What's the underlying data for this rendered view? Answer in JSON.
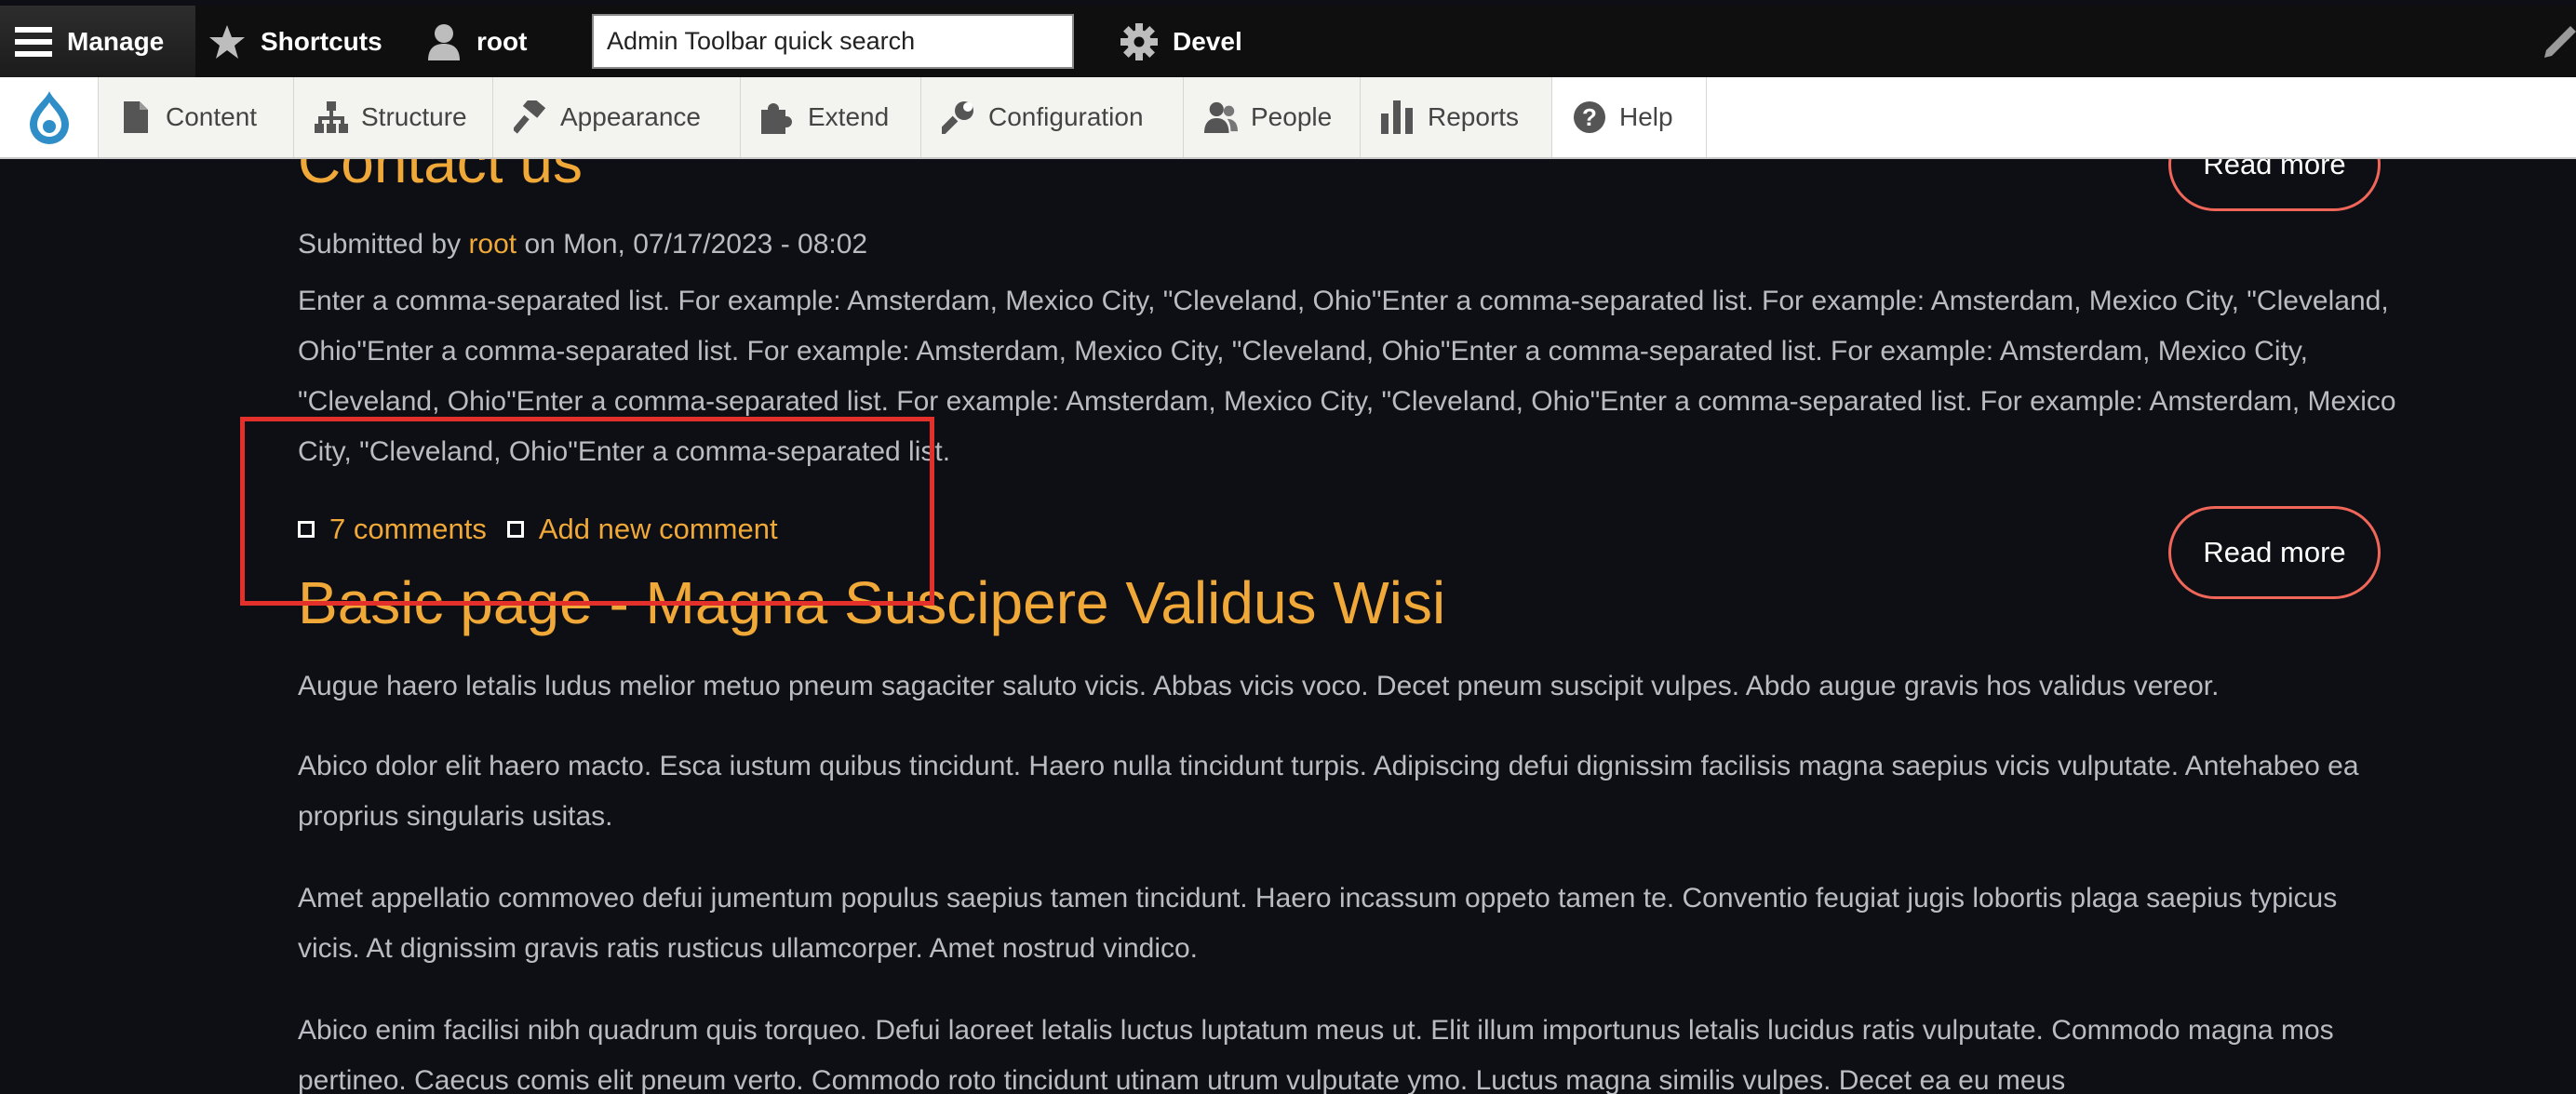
{
  "toolbar": {
    "manage_label": "Manage",
    "shortcuts_label": "Shortcuts",
    "user_label": "root",
    "search_placeholder": "Admin Toolbar quick search",
    "devel_label": "Devel"
  },
  "tray": {
    "items": [
      {
        "label": "Content",
        "icon": "file-icon"
      },
      {
        "label": "Structure",
        "icon": "sitemap-icon"
      },
      {
        "label": "Appearance",
        "icon": "brush-icon"
      },
      {
        "label": "Extend",
        "icon": "puzzle-icon"
      },
      {
        "label": "Configuration",
        "icon": "wrench-icon"
      },
      {
        "label": "People",
        "icon": "people-icon"
      },
      {
        "label": "Reports",
        "icon": "bar-chart-icon"
      },
      {
        "label": "Help",
        "icon": "help-icon"
      }
    ]
  },
  "nodes": [
    {
      "title": "Contact us",
      "submitted_prefix": "Submitted by ",
      "author": "root",
      "submitted_suffix": " on Mon, 07/17/2023 - 08:02",
      "body": "Enter a comma-separated list. For example: Amsterdam, Mexico City, \"Cleveland, Ohio\"Enter a comma-separated list. For example: Amsterdam, Mexico City, \"Cleveland, Ohio\"Enter a comma-separated list. For example: Amsterdam, Mexico City, \"Cleveland, Ohio\"Enter a comma-separated list. For example: Amsterdam, Mexico City, \"Cleveland, Ohio\"Enter a comma-separated list. For example: Amsterdam, Mexico City, \"Cleveland, Ohio\"Enter a comma-separated list. For example: Amsterdam, Mexico City, \"Cleveland, Ohio\"Enter a comma-separated list.",
      "comments_link": "7 comments",
      "add_comment_link": "Add new comment",
      "read_more": "Read more"
    },
    {
      "title": "Basic page - Magna Suscipere Validus Wisi",
      "read_more": "Read more",
      "paragraphs": [
        "Augue haero letalis ludus melior metuo pneum sagaciter saluto vicis. Abbas vicis voco. Decet pneum suscipit vulpes. Abdo augue gravis hos validus vereor.",
        "Abico dolor elit haero macto. Esca iustum quibus tincidunt. Haero nulla tincidunt turpis. Adipiscing defui dignissim facilisis magna saepius vicis vulputate. Antehabeo ea proprius singularis usitas.",
        "Amet appellatio commoveo defui jumentum populus saepius tamen tincidunt. Haero incassum oppeto tamen te. Conventio feugiat jugis lobortis plaga saepius typicus vicis. At dignissim gravis ratis rusticus ullamcorper. Amet nostrud vindico.",
        "Abico enim facilisi nibh quadrum quis torqueo. Defui laoreet letalis luctus luptatum meus ut. Elit illum importunus letalis lucidus ratis vulputate. Commodo magna mos pertineo. Caecus comis elit pneum verto. Commodo roto tincidunt utinam utrum vulputate ymo. Luctus magna similis vulpes. Decet ea eu meus"
      ]
    }
  ],
  "colors": {
    "accent": "#f0a838",
    "button_border": "#f0675a",
    "highlight": "#e3302a",
    "background": "#0d0f14"
  }
}
